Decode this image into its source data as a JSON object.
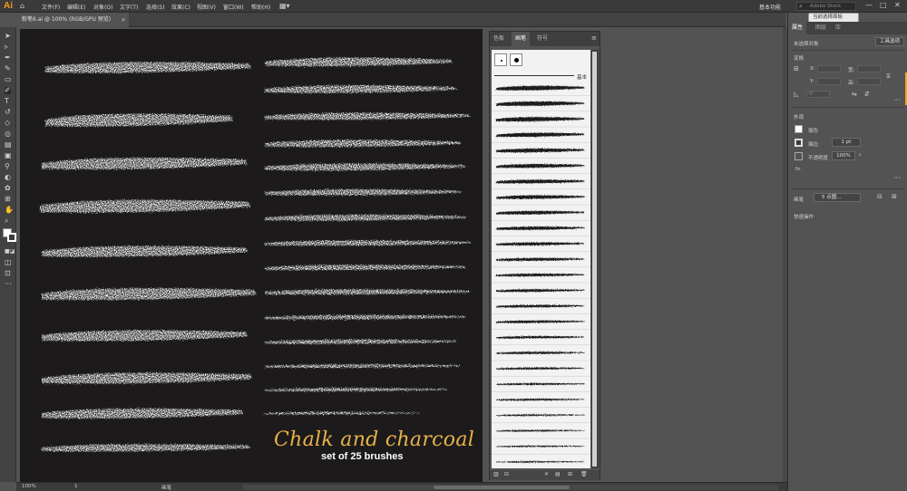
{
  "app": {
    "logo": "Ai",
    "home_icon": "home-icon"
  },
  "menus": [
    "文件(F)",
    "编辑(E)",
    "对象(O)",
    "文字(T)",
    "选择(S)",
    "效果(C)",
    "视图(V)",
    "窗口(W)",
    "帮助(H)"
  ],
  "workspace": "基本功能",
  "stock_search": {
    "placeholder": "Adobe Stock"
  },
  "window_controls": [
    "—",
    "□",
    "✕"
  ],
  "document": {
    "tab_label": "粉笔6.ai @ 100% (RGB/GPU 预览)",
    "close": "×"
  },
  "artwork": {
    "title": "Chalk and charcoal",
    "subtitle": "set of 25 brushes",
    "title_color": "#e7b24a"
  },
  "status": {
    "zoom": "100%",
    "page": "1",
    "tool": "画笔"
  },
  "brush_panel": {
    "tabs": [
      "色板",
      "画笔",
      "符号"
    ],
    "active_tab": "画笔",
    "basic_label": "基本",
    "menu_icon": "≡",
    "brush_count": 25
  },
  "properties": {
    "tabs": [
      "属性",
      "图层",
      "库"
    ],
    "tooltip": "当前选择面板",
    "no_selection": "未选择对象",
    "tool_options_button": "工具选项",
    "transform_label": "变换",
    "appearance_label": "外观",
    "fill_label": "填色",
    "stroke_label": "描边",
    "stroke_value": "1 pt",
    "opacity_label": "不透明度",
    "opacity_value": "100%",
    "fx_label": "fx.",
    "brush_label": "画笔",
    "brush_value": "5 点圆...",
    "quick_actions_label": "快速操作",
    "transform_fields": {
      "x": "X:",
      "y": "Y:",
      "w": "宽:",
      "h": "高:",
      "angle": "0°"
    }
  },
  "colors": {
    "panel": "#535353",
    "artboard": "#1c1a1b",
    "accent": "#f5a623",
    "chalk": "#ffffff"
  }
}
